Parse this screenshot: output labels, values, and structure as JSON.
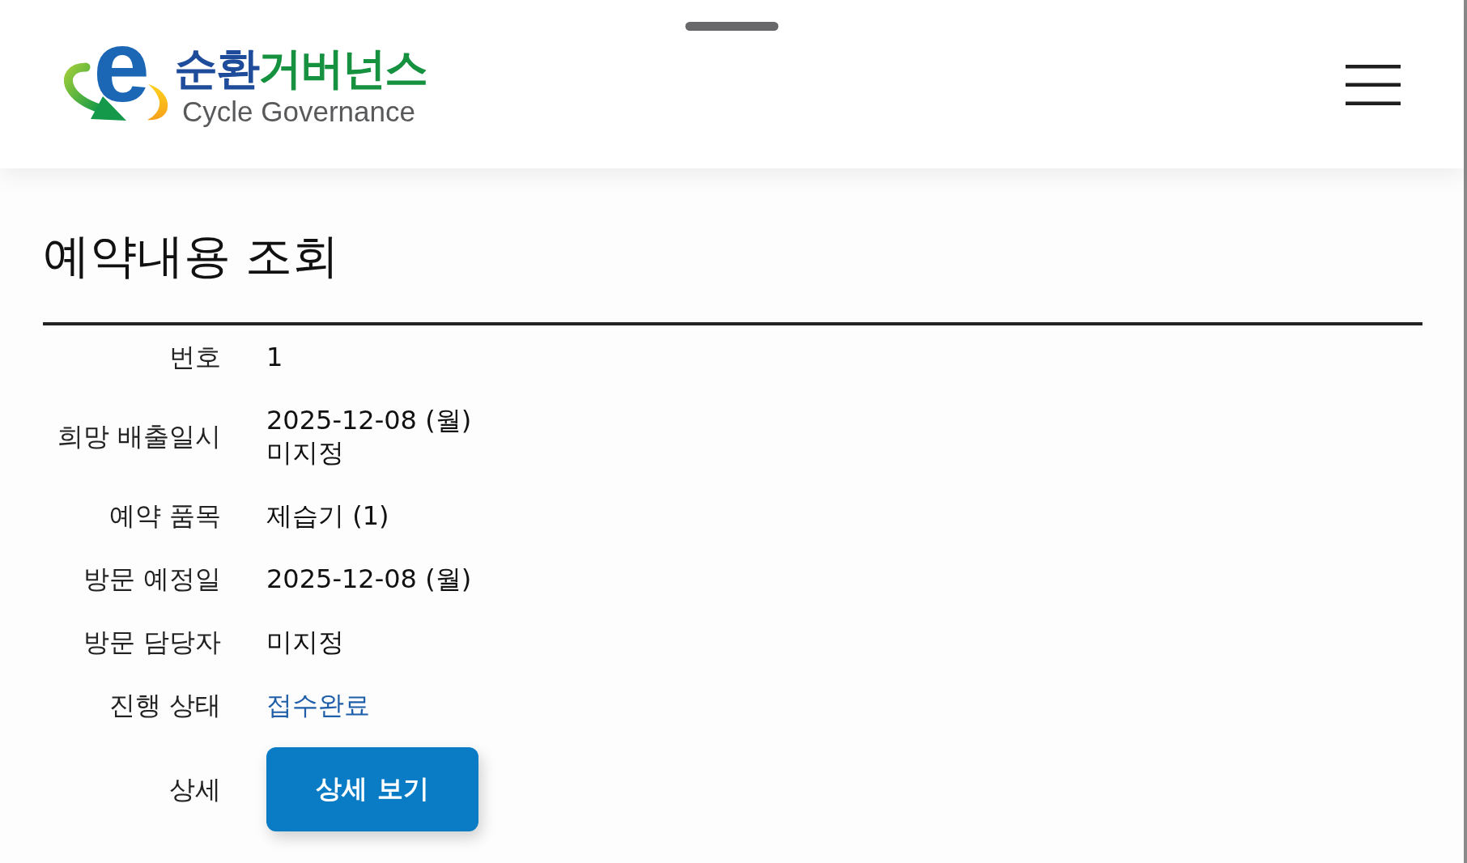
{
  "header": {
    "logo": {
      "mark": "e",
      "title_parts": [
        {
          "text": "순환",
          "color": "#1f4b9b"
        },
        {
          "text": "거버넌스",
          "color": "#15913f"
        }
      ],
      "subtitle": "Cycle Governance"
    }
  },
  "page_title": "예약내용 조회",
  "details": [
    {
      "label": "번호",
      "kind": "text",
      "lines": [
        "1"
      ]
    },
    {
      "label": "희망 배출일시",
      "kind": "text",
      "lines": [
        "2025-12-08 (월)",
        "미지정"
      ]
    },
    {
      "label": "예약 품목",
      "kind": "text",
      "lines": [
        "제습기 (1)"
      ]
    },
    {
      "label": "방문 예정일",
      "kind": "text",
      "lines": [
        "2025-12-08 (월)"
      ]
    },
    {
      "label": "방문 담당자",
      "kind": "text",
      "lines": [
        "미지정"
      ]
    },
    {
      "label": "진행 상태",
      "kind": "status",
      "status": "접수완료"
    },
    {
      "label": "상세",
      "kind": "button",
      "button": "상세 보기"
    }
  ]
}
